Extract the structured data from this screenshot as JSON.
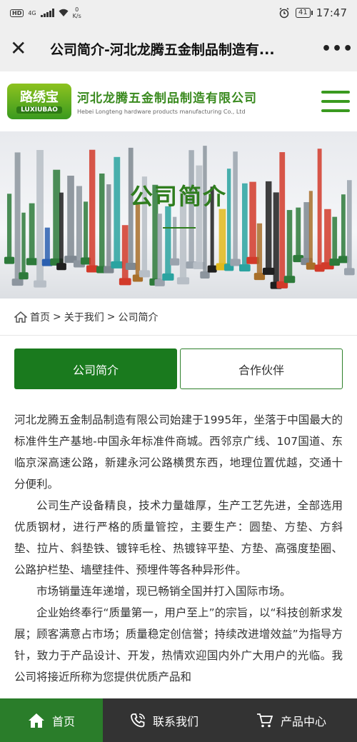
{
  "status_bar": {
    "hd": "HD",
    "network": "4G",
    "speed_value": "0",
    "speed_unit": "K/s",
    "battery": "41",
    "time": "17:47"
  },
  "browser": {
    "title": "公司简介-河北龙腾五金制品制造有...",
    "close_icon": "close-icon",
    "more_label": "•••"
  },
  "header": {
    "logo_text": "路绣宝",
    "logo_sub": "LUXIUBAO",
    "company_cn": "河北龙腾五金制品制造有限公司",
    "company_en": "Hebei Longteng hardware products manufacturing Co., Ltd",
    "accent": "#3a9a1f"
  },
  "banner": {
    "title": "公司简介"
  },
  "breadcrumb": {
    "home": "首页",
    "about": "关于我们",
    "current": "公司简介",
    "sep": ">"
  },
  "tabs": [
    {
      "label": "公司简介",
      "active": true
    },
    {
      "label": "合作伙伴",
      "active": false
    }
  ],
  "content": {
    "p1": "河北龙腾五金制品制造有限公司始建于1995年，坐落于中国最大的标准件生产基地-中国永年标准件商城。西邻京广线、107国道、东临京深高速公路，新建永河公路横贯东西，地理位置优越，交通十分便利。",
    "p2": "公司生产设备精良，技术力量雄厚，生产工艺先进，全部选用优质钢材，进行严格的质量管控，主要生产：圆垫、方垫、方斜垫、拉片、斜垫铁、镀锌毛栓、热镀锌平垫、方垫、高强度垫圈、公路护栏垫、墙壁挂件、预埋件等各种异形件。",
    "p3": "市场销量连年递增，现已畅销全国并打入国际市场。",
    "p4": "企业始终奉行“质量第一，用户至上”的宗旨，以“科技创新求发展；顾客满意占市场；质量稳定创信誉；持续改进增效益”为指导方针，致力于产品设计、开发，热情欢迎国内外广大用户的光临。我公司将接近所称为您提供优质产品和"
  },
  "bottom_nav": {
    "home": "首页",
    "contact": "联系我们",
    "products": "产品中心",
    "home_color": "#2a7d2a",
    "dark_color": "#333333"
  }
}
